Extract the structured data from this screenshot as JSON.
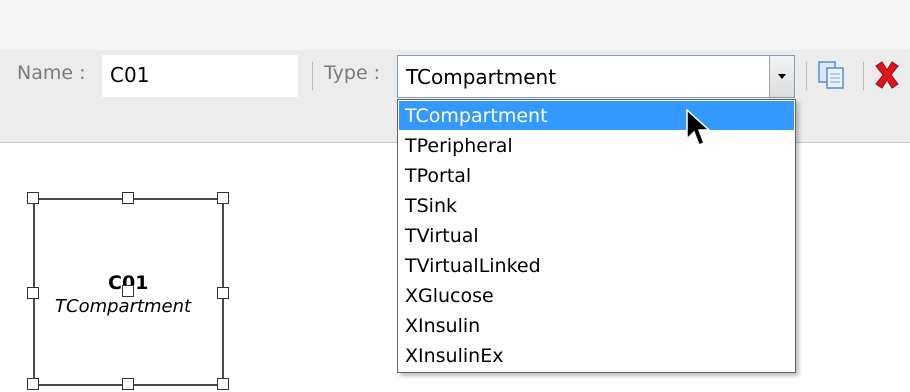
{
  "toolbar": {
    "name_label": "Name :",
    "name_value": "C01",
    "type_label": "Type :",
    "type_value": "TCompartment"
  },
  "dropdown": {
    "options": [
      "TCompartment",
      "TPeripheral",
      "TPortal",
      "TSink",
      "TVirtual",
      "TVirtualLinked",
      "XGlucose",
      "XInsulin",
      "XInsulinEx"
    ],
    "selected": "TCompartment"
  },
  "node": {
    "title": "C01",
    "type": "TCompartment"
  },
  "icons": [
    "copy-icon",
    "delete-icon",
    "chevron-down-icon",
    "mouse-cursor-icon"
  ],
  "colors": {
    "selection": "#3399ff",
    "delete": "#e0151a",
    "toolbar_bg": "#ececec"
  }
}
